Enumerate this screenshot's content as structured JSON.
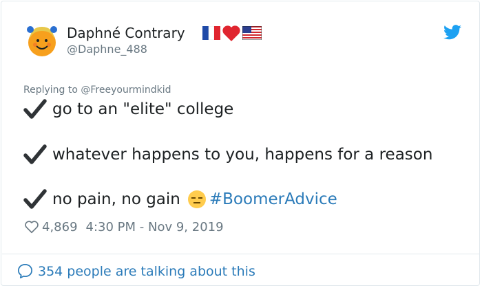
{
  "author": {
    "display_name": "Daphné Contrary",
    "handle": "@Daphne_488",
    "name_emojis": [
      "flag-france-icon",
      "red-heart-icon",
      "flag-usa-icon"
    ],
    "avatar": "little-miss-sunshine-avatar"
  },
  "reply": {
    "prefix": "Replying to ",
    "mention": "@Freeyourmindkid"
  },
  "lines": [
    {
      "check": "check-mark-icon",
      "text": "go to an \"elite\" college"
    },
    {
      "check": "check-mark-icon",
      "text": "whatever happens to you, happens for a reason"
    },
    {
      "check": "check-mark-icon",
      "text": "no pain, no gain",
      "emoji": "expressionless-face-icon",
      "hashtag": "#BoomerAdvice"
    }
  ],
  "meta": {
    "likes": "4,869",
    "timestamp": "4:30 PM - Nov 9, 2019"
  },
  "footer": {
    "talking": "354 people are talking about this"
  },
  "colors": {
    "link": "#2b7bb9",
    "secondary_text": "#697882",
    "primary_text": "#1c2022",
    "twitter_blue": "#1da1f2"
  }
}
